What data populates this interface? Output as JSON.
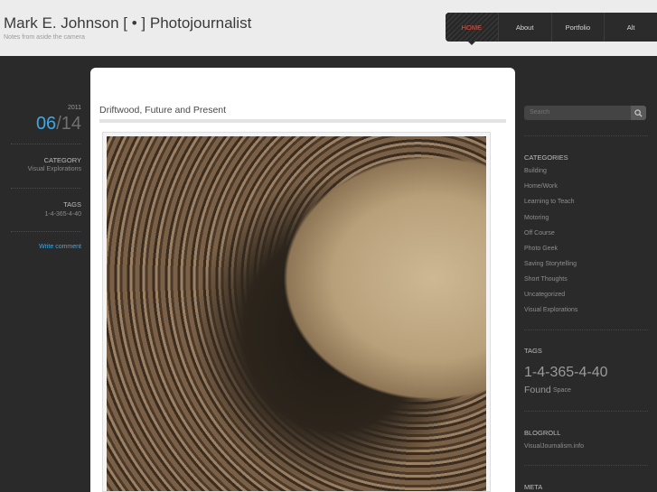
{
  "header": {
    "title": "Mark E. Johnson [ • ] Photojournalist",
    "description": "Notes from aside the camera"
  },
  "nav": {
    "items": [
      {
        "label": "HOME",
        "active": true
      },
      {
        "label": "About",
        "active": false
      },
      {
        "label": "Portfolio",
        "active": false
      },
      {
        "label": "Alt",
        "active": false
      }
    ]
  },
  "post_meta": {
    "year": "2011",
    "month": "06",
    "separator": "/",
    "day": "14",
    "category_label": "CATEGORY",
    "category_value": "Visual Explorations",
    "tags_label": "TAGS",
    "tags_value": "1-4-365-4-40",
    "comment_link": "Write comment"
  },
  "post": {
    "title": "Driftwood, Future and Present"
  },
  "sidebar": {
    "search_placeholder": "Search",
    "categories_heading": "CATEGORIES",
    "categories": [
      "Building",
      "Home/Work",
      "Learning to Teach",
      "Motoring",
      "Off Course",
      "Photo Geek",
      "Saving Storytelling",
      "Short Thoughts",
      "Uncategorized",
      "Visual Explorations"
    ],
    "tags_heading": "TAGS",
    "tag_big": "1-4-365-4-40",
    "tag_found": "Found",
    "tag_space": "Space",
    "blogroll_heading": "BLOGROLL",
    "blogroll": [
      "VisualJournalism.info"
    ],
    "meta_heading": "META"
  },
  "colors": {
    "accent_blue": "#3ea9e4",
    "nav_active": "#e8503a",
    "dark_panel": "#2a2a2a"
  }
}
